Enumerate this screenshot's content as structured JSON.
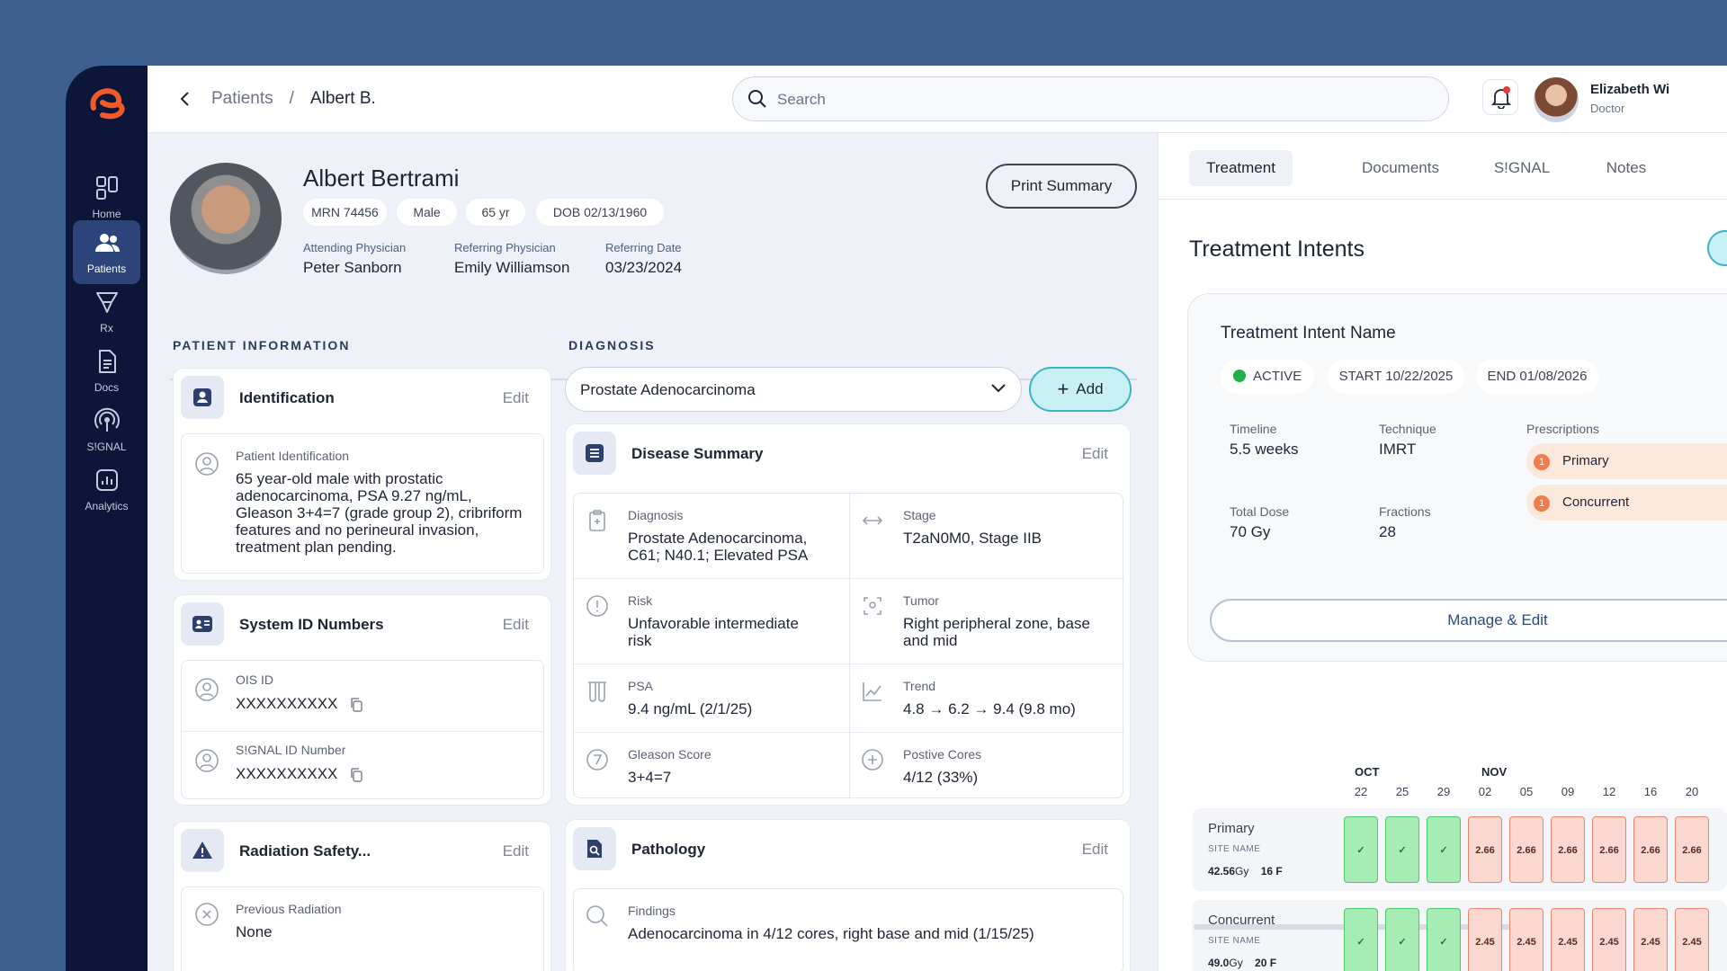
{
  "breadcrumb": {
    "parent": "Patients",
    "separator": "/",
    "current": "Albert B."
  },
  "search": {
    "placeholder": "Search"
  },
  "user": {
    "name": "Elizabeth Wi",
    "role": "Doctor"
  },
  "nav": [
    {
      "label": "Home"
    },
    {
      "label": "Patients"
    },
    {
      "label": "Rx"
    },
    {
      "label": "Docs"
    },
    {
      "label": "S!GNAL"
    },
    {
      "label": "Analytics"
    }
  ],
  "patient": {
    "name": "Albert Bertrami",
    "mrn": "MRN 74456",
    "sex": "Male",
    "age": "65 yr",
    "dob": "DOB 02/13/1960",
    "attending_label": "Attending Physician",
    "attending": "Peter Sanborn",
    "referring_label": "Referring Physician",
    "referring": "Emily Williamson",
    "ref_date_label": "Referring Date",
    "ref_date": "03/23/2024"
  },
  "print_label": "Print Summary",
  "sections": {
    "patient_info": "PATIENT INFORMATION",
    "diagnosis": "DIAGNOSIS"
  },
  "edit_label": "Edit",
  "identification": {
    "title": "Identification",
    "label": "Patient Identification",
    "value": "65 year-old male with prostatic adenocarcinoma, PSA 9.27 ng/mL, Gleason 3+4=7 (grade group 2), cribriform features and no perineural invasion, treatment plan pending."
  },
  "system_ids": {
    "title": "System ID Numbers",
    "ois_label": "OIS ID",
    "ois_value": "XXXXXXXXXX",
    "signal_label": "S!GNAL ID Number",
    "signal_value": "XXXXXXXXXX"
  },
  "radiation": {
    "title": "Radiation Safety...",
    "label": "Previous Radiation",
    "value": "None"
  },
  "diagnosis_select": "Prostate Adenocarcinoma",
  "add_label": "Add",
  "disease": {
    "title": "Disease Summary",
    "diag_label": "Diagnosis",
    "diag_value": "Prostate Adenocarcinoma, C61; N40.1; Elevated PSA",
    "stage_label": "Stage",
    "stage_value": "T2aN0M0, Stage IIB",
    "risk_label": "Risk",
    "risk_value": "Unfavorable intermediate risk",
    "tumor_label": "Tumor",
    "tumor_value": "Right peripheral zone, base and mid",
    "psa_label": "PSA",
    "psa_value": "9.4 ng/mL (2/1/25)",
    "trend_label": "Trend",
    "trend_value": "4.8 → 6.2 → 9.4 (9.8 mo)",
    "gleason_label": "Gleason Score",
    "gleason_value": "3+4=7",
    "cores_label": "Postive Cores",
    "cores_value": "4/12 (33%)"
  },
  "pathology": {
    "title": "Pathology",
    "label": "Findings",
    "value": "Adenocarcinoma in 4/12 cores, right base and mid (1/15/25)"
  },
  "tabs": [
    {
      "label": "Treatment"
    },
    {
      "label": "Documents"
    },
    {
      "label": "S!GNAL"
    },
    {
      "label": "Notes"
    }
  ],
  "intents": {
    "title": "Treatment Intents",
    "card_title": "Treatment Intent Name",
    "status": "ACTIVE",
    "start": "START 10/22/2025",
    "end": "END 01/08/2026",
    "timeline_label": "Timeline",
    "timeline": "5.5 weeks",
    "technique_label": "Technique",
    "technique": "IMRT",
    "dose_label": "Total Dose",
    "dose": "70 Gy",
    "fractions_label": "Fractions",
    "fractions": "28",
    "prescriptions_label": "Prescriptions",
    "rx1": "Primary",
    "rx2": "Concurrent",
    "rx_badge": "1",
    "manage": "Manage & Edit"
  },
  "calendar": {
    "months": [
      "OCT",
      "NOV"
    ],
    "days": [
      "22",
      "25",
      "29",
      "02",
      "05",
      "09",
      "12",
      "16",
      "20"
    ],
    "rows": [
      {
        "name": "Primary",
        "site": "SITE NAME",
        "dose": "42.56",
        "unit": "Gy",
        "fx": "16 F",
        "values": [
          "✓",
          "✓",
          "✓",
          "2.66",
          "2.66",
          "2.66",
          "2.66",
          "2.66",
          "2.66"
        ]
      },
      {
        "name": "Concurrent",
        "site": "SITE NAME",
        "dose": "49.0",
        "unit": "Gy",
        "fx": "20 F",
        "values": [
          "✓",
          "✓",
          "✓",
          "2.45",
          "2.45",
          "2.45",
          "2.45",
          "2.45",
          "2.45"
        ]
      }
    ]
  },
  "colors": {
    "accent": "#38b5c7",
    "nav_bg": "#0b1638",
    "done": "#a6ecb4",
    "pending": "#fbd9d1"
  }
}
